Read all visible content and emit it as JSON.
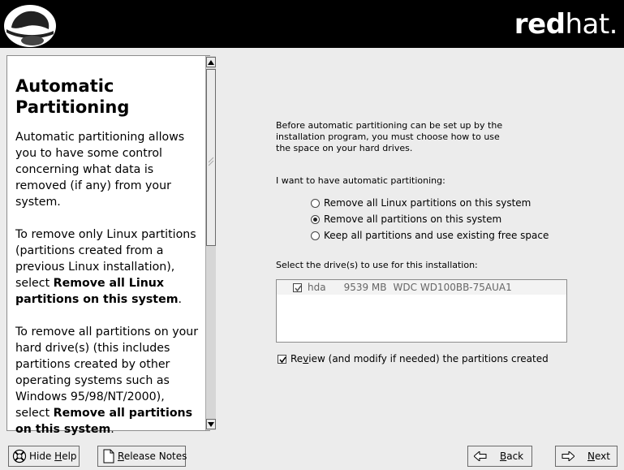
{
  "header": {
    "brand_bold": "red",
    "brand_thin": "hat."
  },
  "help": {
    "title_line1": "Automatic",
    "title_line2": "Partitioning",
    "para1": "Automatic partitioning allows you to have some control concerning what data is removed (if any) from your system.",
    "para2_prefix": "To remove only Linux partitions (partitions created from a previous Linux installation), select ",
    "para2_bold": "Remove all Linux partitions on this system",
    "para2_suffix": ".",
    "para3_prefix": "To remove all partitions on your hard drive(s) (this includes partitions created by other operating systems such as Windows 95/98/NT/2000), select ",
    "para3_bold": "Remove all partitions on this system",
    "para3_suffix": "."
  },
  "main": {
    "intro": "Before automatic partitioning can be set up by the installation program, you must choose how to use the space on your hard drives.",
    "question": "I want to have automatic partitioning:",
    "options": [
      {
        "label": "Remove all Linux partitions on this system",
        "selected": false
      },
      {
        "label": "Remove all partitions on this system",
        "selected": true
      },
      {
        "label": "Keep all partitions and use existing free space",
        "selected": false
      }
    ],
    "drives_label": "Select the drive(s) to use for this installation:",
    "drives": [
      {
        "checked": true,
        "name": "hda",
        "size": "9539 MB",
        "model": "WDC WD100BB-75AUA1"
      }
    ],
    "review": {
      "checked": true,
      "label_before": "Re",
      "label_accel": "v",
      "label_after": "iew (and modify if needed) the partitions created"
    }
  },
  "buttons": {
    "hide_help_prefix": "Hide ",
    "hide_help_accel": "H",
    "hide_help_suffix": "elp",
    "release_notes_accel": "R",
    "release_notes_suffix": "elease Notes",
    "back_accel": "B",
    "back_suffix": "ack",
    "next_accel": "N",
    "next_suffix": "ext"
  },
  "icons": {
    "logo": "redhat-shadowman-logo",
    "help": "lifebuoy-icon",
    "notes": "document-icon",
    "back": "left-arrow-icon",
    "next": "right-arrow-icon"
  }
}
